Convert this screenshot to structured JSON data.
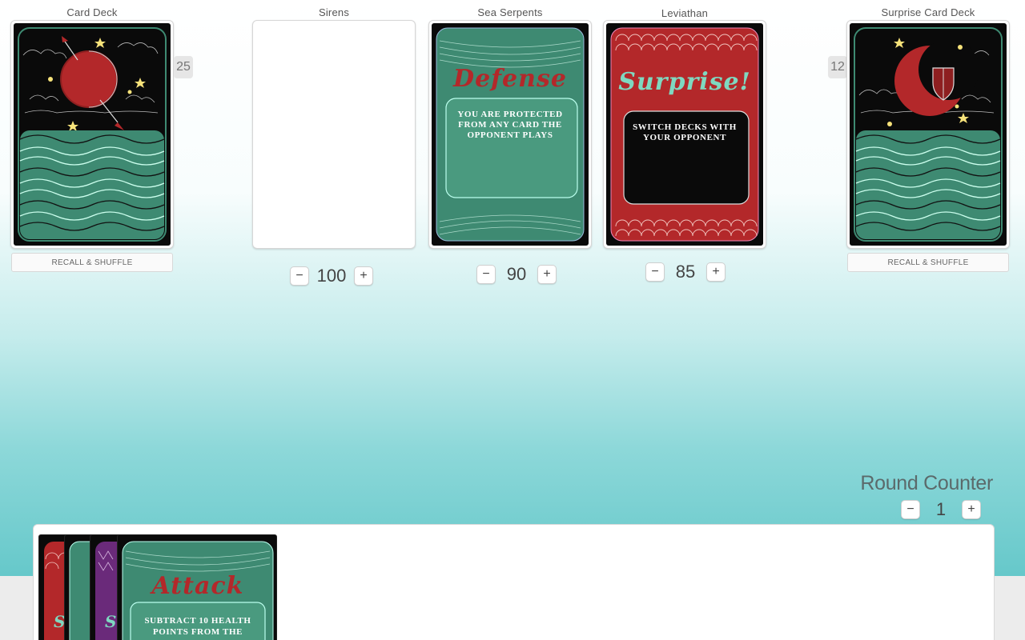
{
  "colors": {
    "teal_card": "#3e8a72",
    "teal_panel": "#4a9a7f",
    "red": "#b3282a",
    "dark_red": "#8e1f20",
    "black": "#0a0a0a",
    "star": "#f6e27a",
    "purple": "#6a2a7a"
  },
  "deck_left": {
    "title": "Card Deck",
    "count": "25",
    "recall_label": "RECALL & SHUFFLE"
  },
  "sirens": {
    "title": "Sirens",
    "value": "100",
    "minus": "−",
    "plus": "+"
  },
  "sea_serpents": {
    "title": "Sea Serpents",
    "value": "90",
    "minus": "−",
    "plus": "+",
    "card": {
      "heading": "Defense",
      "text": "You are protected from any card the opponent plays"
    }
  },
  "leviathan": {
    "title": "Leviathan",
    "value": "85",
    "minus": "−",
    "plus": "+",
    "card": {
      "heading": "Surprise!",
      "text": "Switch decks with your opponent"
    }
  },
  "deck_right": {
    "title": "Surprise Card Deck",
    "count": "12",
    "recall_label": "RECALL & SHUFFLE"
  },
  "round_counter": {
    "title": "Round Counter",
    "value": "1",
    "minus": "−",
    "plus": "+"
  },
  "hand": {
    "cards": [
      {
        "heading": "S",
        "color": "red"
      },
      {
        "heading": "",
        "color": "teal"
      },
      {
        "heading": "S",
        "color": "purple"
      },
      {
        "heading": "Attack",
        "text": "Subtract 10 health points from the",
        "color": "teal"
      }
    ]
  }
}
